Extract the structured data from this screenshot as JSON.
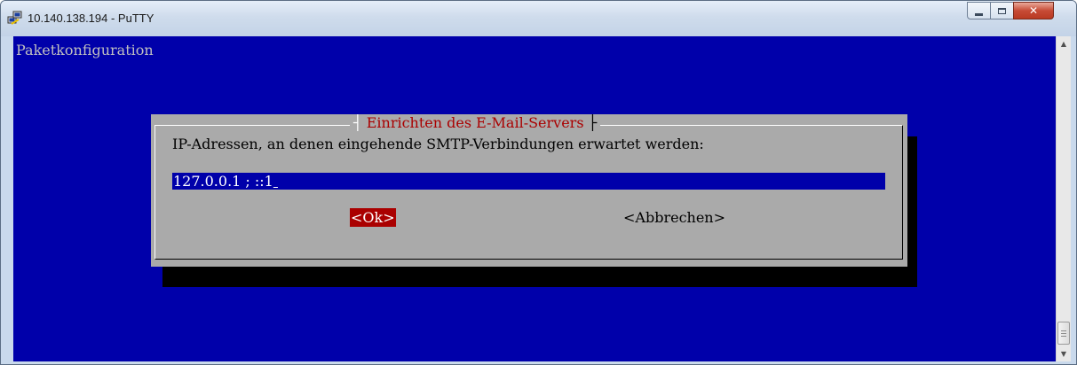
{
  "window": {
    "title": "10.140.138.194 - PuTTY",
    "app_icon": "putty-icon",
    "controls": {
      "minimize": "minimize-icon",
      "maximize": "maximize-icon",
      "close": "close-icon"
    }
  },
  "terminal": {
    "screen_title": "Paketkonfiguration",
    "background_color": "#0000aa",
    "dialog": {
      "title": "Einrichten des E-Mail-Servers",
      "prompt": "IP-Adressen, an denen eingehende SMTP-Verbindungen erwartet werden:",
      "input_value": "127.0.0.1 ; ::1",
      "ok_label": "<Ok>",
      "cancel_label": "<Abbrechen>",
      "colors": {
        "dialog_bg": "#aaaaaa",
        "title_text": "#aa0000",
        "selected_button_bg": "#aa0000",
        "input_bg": "#0000aa"
      }
    }
  },
  "scrollbar": {
    "up_icon": "arrow-up-icon",
    "down_icon": "arrow-down-icon",
    "position": "bottom"
  }
}
